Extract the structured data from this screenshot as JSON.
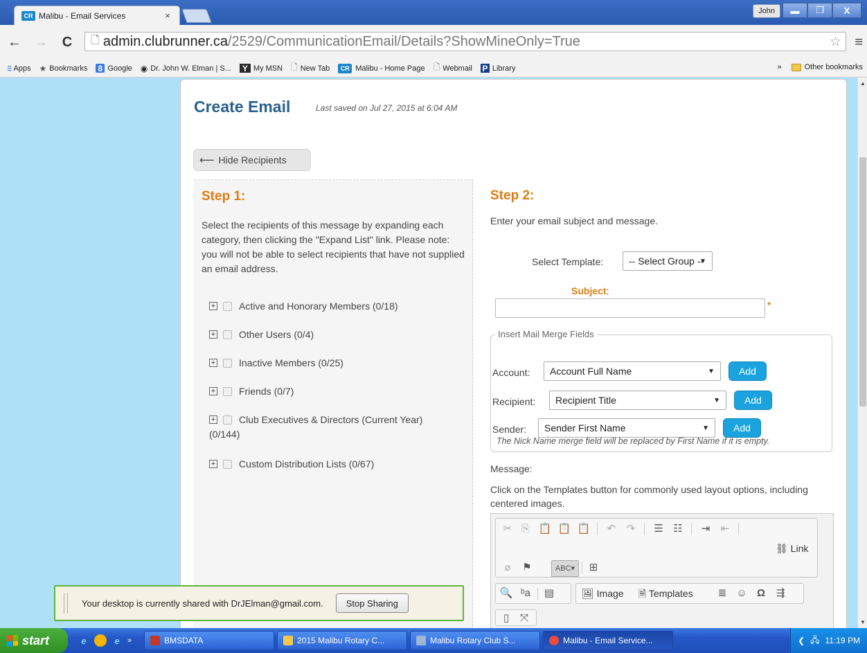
{
  "browser": {
    "tab_favicon": "CR",
    "tab_title": "Malibu - Email Services",
    "tab_close": "×",
    "user_button": "John",
    "window_buttons": {
      "minimize": "▬",
      "maximize": "❐",
      "close": "X"
    },
    "url_domain": "admin.clubrunner.ca",
    "url_path": "/2529/CommunicationEmail/Details?ShowMineOnly=True"
  },
  "bookmarks": {
    "items": [
      {
        "icon": "apps-icon",
        "label": "Apps"
      },
      {
        "icon": "star-icon",
        "label": "Bookmarks"
      },
      {
        "icon": "google-icon",
        "label": "Google"
      },
      {
        "icon": "eye-icon",
        "label": "Dr. John W. Elman | S..."
      },
      {
        "icon": "msn-icon",
        "label": "My MSN"
      },
      {
        "icon": "page-icon",
        "label": "New Tab"
      },
      {
        "icon": "clubrunner-icon",
        "label": "Malibu - Home Page"
      },
      {
        "icon": "page-icon",
        "label": "Webmail"
      },
      {
        "icon": "library-icon",
        "label": "Library"
      }
    ],
    "overflow": "»",
    "other": "Other bookmarks"
  },
  "page": {
    "title": "Create Email",
    "last_saved": "Last saved on Jul 27, 2015 at 6:04 AM",
    "hide_recipients": "Hide Recipients"
  },
  "step1": {
    "heading": "Step 1:",
    "description": "Select the recipients of this message by expanding each category, then clicking the \"Expand List\" link. Please note: you will not be able to select recipients that have not supplied an email address.",
    "categories": [
      {
        "label": "Active and Honorary Members (0/18)"
      },
      {
        "label": "Other Users (0/4)"
      },
      {
        "label": "Inactive Members (0/25)"
      },
      {
        "label": "Friends (0/7)"
      },
      {
        "label": "Club Executives & Directors (Current Year)",
        "label2": "(0/144)"
      },
      {
        "label": "Custom Distribution Lists (0/67)"
      }
    ]
  },
  "step2": {
    "heading": "Step 2:",
    "description": "Enter your email subject and message.",
    "template_label": "Select Template:",
    "template_value": "-- Select Group --",
    "subject_label": "Subject",
    "subject_colon": ":",
    "subject_value": "",
    "required_mark": "*",
    "merge": {
      "legend": "Insert Mail Merge Fields",
      "account_label": "Account:",
      "account_value": "Account Full Name",
      "recipient_label": "Recipient:",
      "recipient_value": "Recipient Title",
      "sender_label": "Sender:",
      "sender_value": "Sender First Name",
      "add_label": "Add",
      "note": "The Nick Name merge field will be replaced by First Name if it is empty."
    },
    "message_label": "Message:",
    "message_help": "Click on the Templates button for commonly used layout options, including centered images.",
    "editor": {
      "link_label": "Link",
      "image_label": "Image",
      "templates_label": "Templates"
    }
  },
  "sharing": {
    "message": "Your desktop is currently shared with DrJElman@gmail.com.",
    "stop_label": "Stop Sharing"
  },
  "taskbar": {
    "start_label": "start",
    "quick_overflow": "»",
    "tasks": [
      {
        "label": "BMSDATA",
        "color": "#c0392b"
      },
      {
        "label": "2015 Malibu Rotary C...",
        "color": "#f2c94c"
      },
      {
        "label": "Malibu Rotary Club S...",
        "color": "#9fb6d9"
      },
      {
        "label": "Malibu - Email Service...",
        "color": "#e74c3c"
      }
    ],
    "clock": "11:19 PM"
  }
}
